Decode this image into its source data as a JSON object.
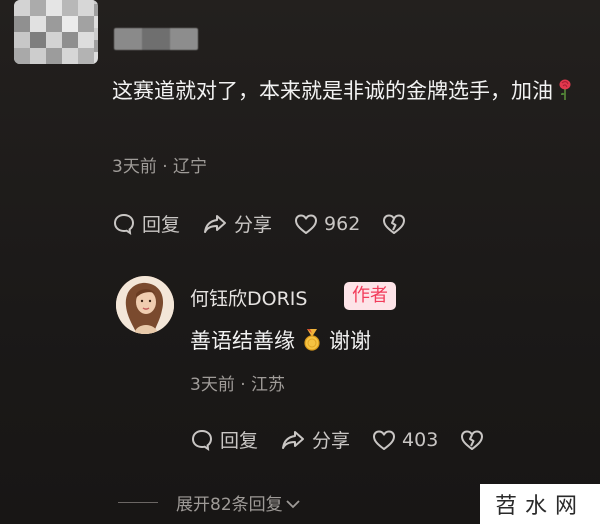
{
  "comment": {
    "text": "这赛道就对了，本来就是非诚的金牌选手，加油",
    "emoji_icon": "rose-icon",
    "time": "3天前",
    "location": "辽宁",
    "reply_label": "回复",
    "share_label": "分享",
    "like_count": "962"
  },
  "reply": {
    "author": "何钰欣DORIS",
    "badge": "作者",
    "text_before": "善语结善缘",
    "emoji_icon": "medal-icon",
    "text_after": "谢谢",
    "time": "3天前",
    "location": "江苏",
    "reply_label": "回复",
    "share_label": "分享",
    "like_count": "403"
  },
  "expand_replies": "展开82条回复",
  "watermark": "苕水网",
  "colors": {
    "badge_bg": "#fde4e8",
    "badge_text": "#f23c5b",
    "meta_text": "#a09c99"
  }
}
